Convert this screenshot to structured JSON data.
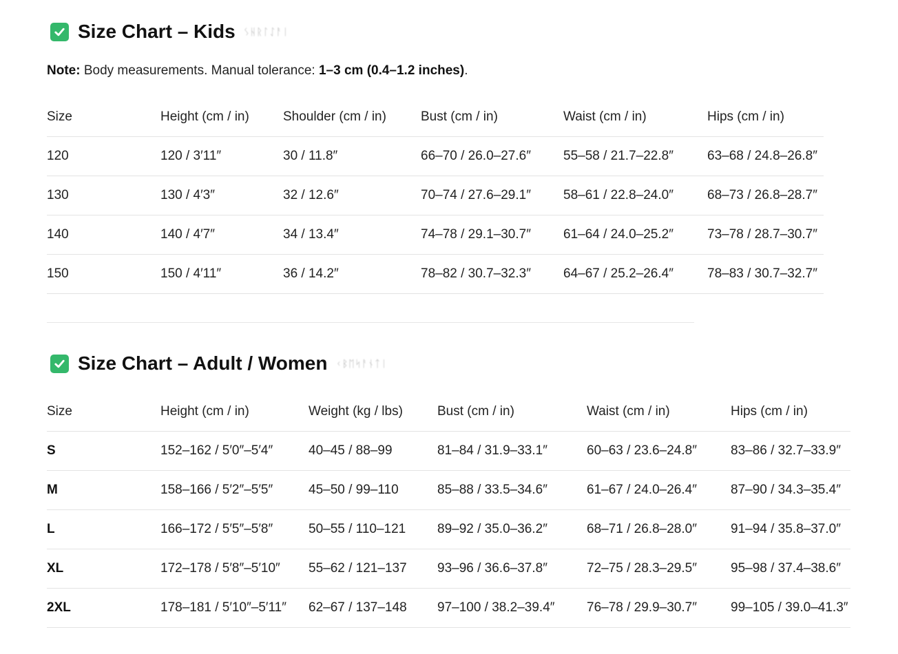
{
  "kids": {
    "title": "Size Chart – Kids",
    "title_suffix": "ᛊᚺᚱᛚᛇᚨᛁ",
    "note_label": "Note:",
    "note_text": " Body measurements. Manual tolerance: ",
    "note_value": "1–3 cm (0.4–1.2 inches)",
    "note_end": ".",
    "headers": [
      "Size",
      "Height (cm / in)",
      "Shoulder (cm / in)",
      "Bust (cm / in)",
      "Waist (cm / in)",
      "Hips (cm / in)"
    ],
    "rows": [
      [
        "120",
        "120 / 3′11″",
        "30 / 11.8″",
        "66–70 / 26.0–27.6″",
        "55–58 / 21.7–22.8″",
        "63–68 / 24.8–26.8″"
      ],
      [
        "130",
        "130 / 4′3″",
        "32 / 12.6″",
        "70–74 / 27.6–29.1″",
        "58–61 / 22.8–24.0″",
        "68–73 / 26.8–28.7″"
      ],
      [
        "140",
        "140 / 4′7″",
        "34 / 13.4″",
        "74–78 / 29.1–30.7″",
        "61–64 / 24.0–25.2″",
        "73–78 / 28.7–30.7″"
      ],
      [
        "150",
        "150 / 4′11″",
        "36 / 14.2″",
        "78–82 / 30.7–32.3″",
        "64–67 / 25.2–26.4″",
        "78–83 / 30.7–32.7″"
      ]
    ]
  },
  "women": {
    "title": "Size Chart – Adult / Women",
    "title_suffix": "ᚲᛒᛖᛋᚨᚾᛏᛁ",
    "headers": [
      "Size",
      "Height (cm / in)",
      "Weight (kg / lbs)",
      "Bust (cm / in)",
      "Waist (cm / in)",
      "Hips (cm / in)"
    ],
    "rows": [
      [
        "S",
        "152–162 / 5′0″–5′4″",
        "40–45 / 88–99",
        "81–84 / 31.9–33.1″",
        "60–63 / 23.6–24.8″",
        "83–86 / 32.7–33.9″"
      ],
      [
        "M",
        "158–166 / 5′2″–5′5″",
        "45–50 / 99–110",
        "85–88 / 33.5–34.6″",
        "61–67 / 24.0–26.4″",
        "87–90 / 34.3–35.4″"
      ],
      [
        "L",
        "166–172 / 5′5″–5′8″",
        "50–55 / 110–121",
        "89–92 / 35.0–36.2″",
        "68–71 / 26.8–28.0″",
        "91–94 / 35.8–37.0″"
      ],
      [
        "XL",
        "172–178 / 5′8″–5′10″",
        "55–62 / 121–137",
        "93–96 / 36.6–37.8″",
        "72–75 / 28.3–29.5″",
        "95–98 / 37.4–38.6″"
      ],
      [
        "2XL",
        "178–181 / 5′10″–5′11″",
        "62–67 / 137–148",
        "97–100 / 38.2–39.4″",
        "76–78 / 29.9–30.7″",
        "99–105 / 39.0–41.3″"
      ]
    ]
  },
  "colors": {
    "check_badge": "#34b86b",
    "row_divider": "#e3e3e3"
  },
  "icons": {
    "heading_icon": "check-mark-icon"
  }
}
